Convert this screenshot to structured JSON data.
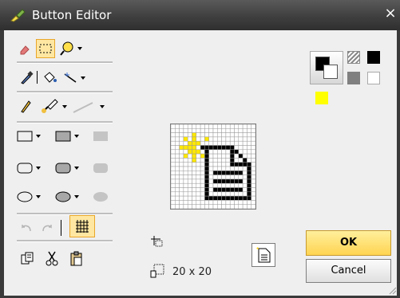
{
  "window": {
    "title": "Button Editor",
    "close_glyph": "×"
  },
  "icons": {
    "title": "paintbrush-icon",
    "tools": [
      "eraser-icon",
      "select-rectangle-icon",
      "zoom-icon",
      "dropper-icon",
      "fill-icon",
      "sparkle-pen-icon",
      "pencil-icon",
      "brush-icon",
      "line-icon",
      "rect-outline-icon",
      "rect-filled-icon",
      "rect-solid-icon",
      "rounded-rect-outline-icon",
      "rounded-rect-filled-icon",
      "rounded-rect-solid-icon",
      "ellipse-outline-icon",
      "ellipse-filled-icon",
      "ellipse-solid-icon",
      "undo-icon",
      "redo-icon",
      "grid-icon",
      "copy-icon",
      "cut-icon",
      "paste-icon",
      "move-icon",
      "resize-icon"
    ]
  },
  "canvas": {
    "grid_cells": 20
  },
  "size": {
    "label": "20 x 20"
  },
  "colors": {
    "foreground": "#000000",
    "background": "#ffffff",
    "palette": [
      "pattern",
      "#000000",
      "#808080",
      "#ffffff",
      "#ffff00"
    ],
    "accent_selected": "#ffe7a2"
  },
  "buttons": {
    "ok": "OK",
    "cancel": "Cancel"
  }
}
